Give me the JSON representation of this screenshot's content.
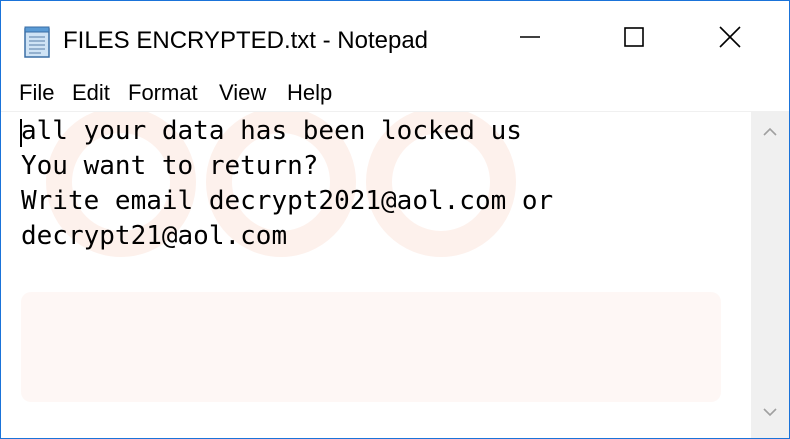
{
  "window": {
    "title": "FILES ENCRYPTED.txt - Notepad",
    "app_icon": "notepad-icon",
    "buttons": {
      "minimize_icon": "minimize-icon",
      "maximize_icon": "maximize-icon",
      "close_icon": "close-icon"
    },
    "border_color": "#1a73d9"
  },
  "menu": {
    "items": [
      {
        "label": "File"
      },
      {
        "label": "Edit"
      },
      {
        "label": "Format"
      },
      {
        "label": "View"
      },
      {
        "label": "Help"
      }
    ]
  },
  "editor": {
    "lines": [
      "all your data has been locked us",
      "You want to return?",
      "Write email decrypt2021@aol.com or",
      "decrypt21@aol.com"
    ]
  },
  "scrollbar": {
    "up_icon": "scroll-up-arrow-icon",
    "down_icon": "scroll-down-arrow-icon"
  }
}
